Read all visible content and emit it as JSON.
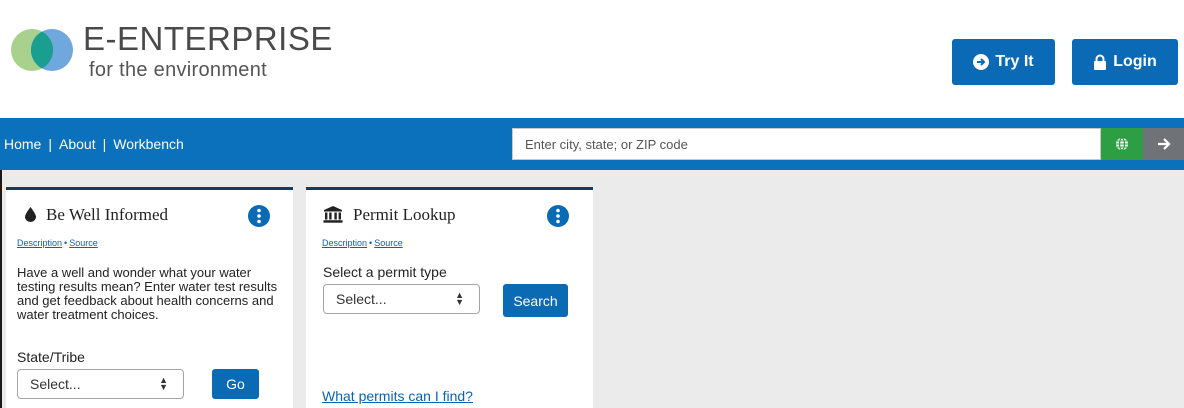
{
  "brand": {
    "title": "E-ENTERPRISE",
    "subtitle": "for the environment",
    "logo_icon": "two-overlapping-circles-logo",
    "colors": {
      "left_circle": "#a9d18e",
      "right_circle": "#6fa8dc",
      "overlap": "#1a9e8f"
    }
  },
  "header": {
    "tryit_label": "Try It",
    "tryit_icon": "arrow-circle-right-icon",
    "login_label": "Login",
    "login_icon": "lock-icon"
  },
  "nav": {
    "links": [
      "Home",
      "About",
      "Workbench"
    ],
    "separator": "|",
    "search_placeholder": "Enter city, state; or ZIP code",
    "globe_icon": "globe-icon",
    "go_icon": "arrow-right-icon"
  },
  "cards": [
    {
      "title": "Be Well Informed",
      "icon": "water-drop-icon",
      "info_icon": "info-icon",
      "description_link": "Description",
      "source_link": "Source",
      "description": "Have a well and wonder what your water testing results mean? Enter water test results and get feedback about health concerns and water treatment choices.",
      "field_label": "State/Tribe",
      "select_value": "Select...",
      "button_label": "Go"
    },
    {
      "title": "Permit Lookup",
      "icon": "government-building-icon",
      "info_icon": "info-icon",
      "description_link": "Description",
      "source_link": "Source",
      "field_label": "Select a permit type",
      "select_value": "Select...",
      "button_label": "Search",
      "help_link": "What permits can I find?"
    }
  ],
  "colors": {
    "primary_blue": "#0b71bd",
    "button_blue": "#0b6ab4",
    "globe_green": "#2e9e45",
    "arrow_gray": "#6f7378",
    "card_border": "#0f3d63"
  }
}
